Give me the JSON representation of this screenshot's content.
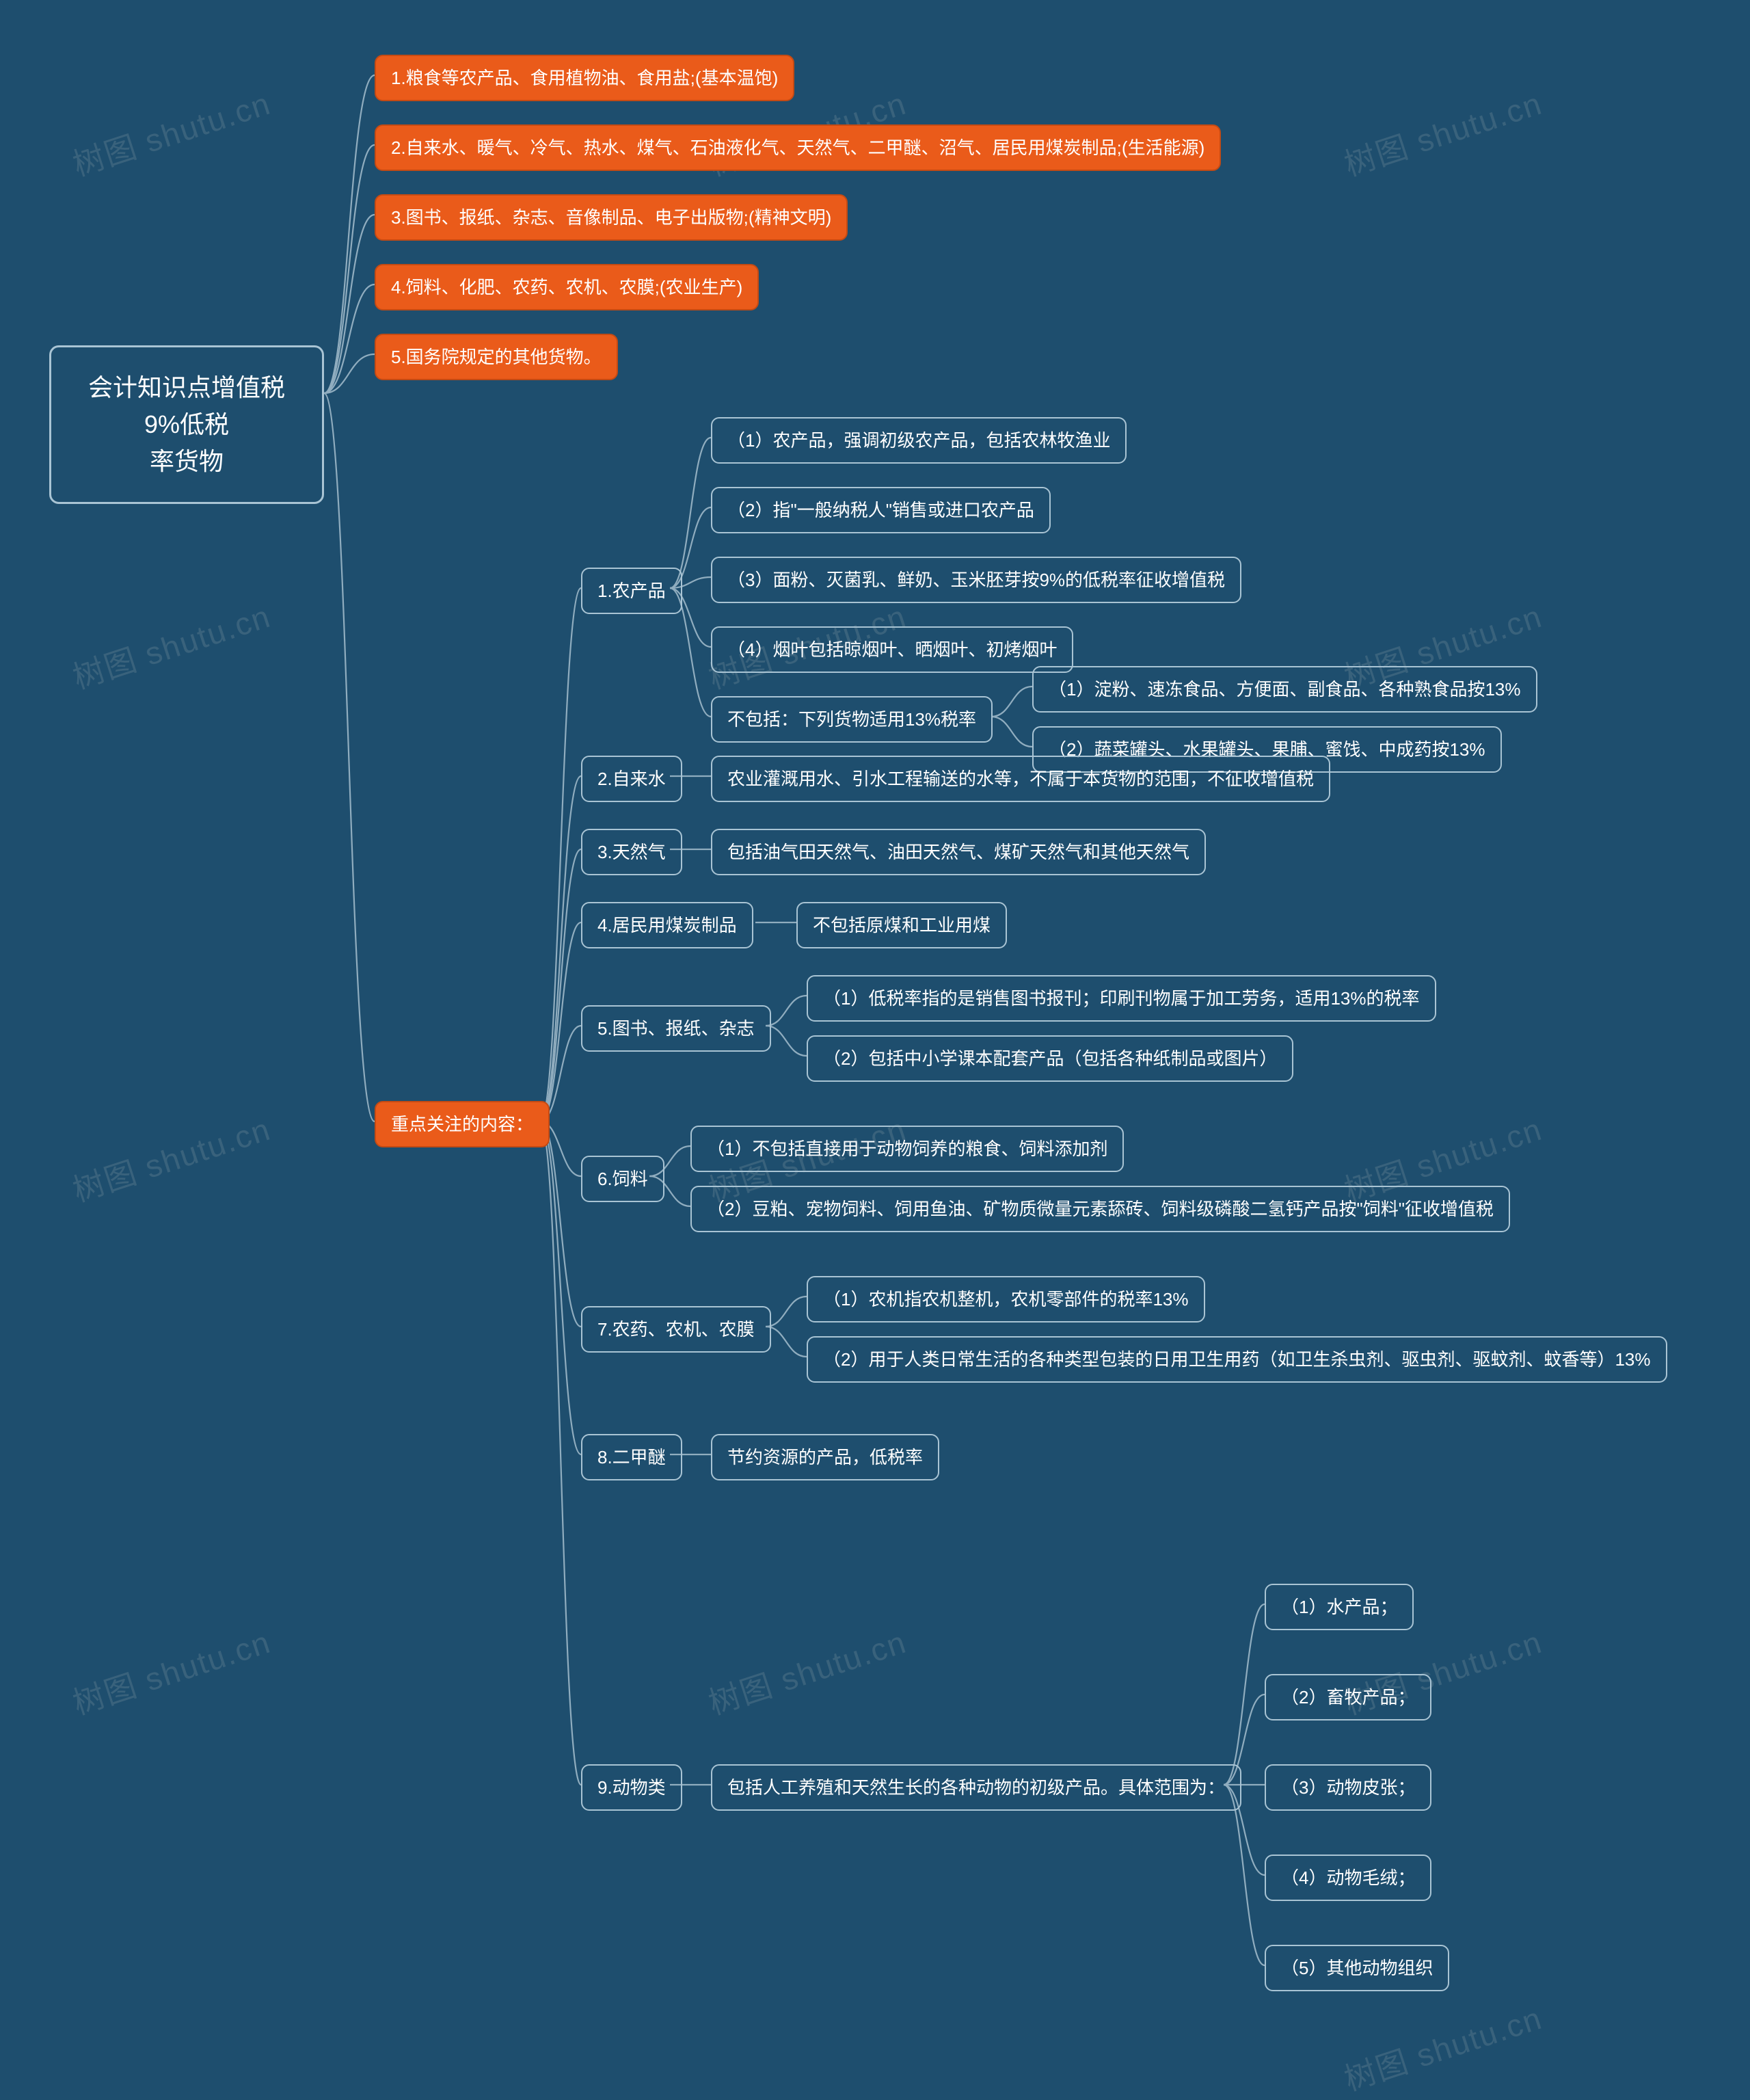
{
  "watermark": "树图 shutu.cn",
  "root": {
    "line1": "会计知识点增值税9%低税",
    "line2": "率货物"
  },
  "top_items": {
    "i1": "1.粮食等农产品、食用植物油、食用盐;(基本温饱)",
    "i2": "2.自来水、暖气、冷气、热水、煤气、石油液化气、天然气、二甲醚、沼气、居民用煤炭制品;(生活能源)",
    "i3": "3.图书、报纸、杂志、音像制品、电子出版物;(精神文明)",
    "i4": "4.饲料、化肥、农药、农机、农膜;(农业生产)",
    "i5": "5.国务院规定的其他货物。"
  },
  "focus_label": "重点关注的内容：",
  "focus": {
    "n1": "1.农产品",
    "n1_c1": "（1）农产品，强调初级农产品，包括农林牧渔业",
    "n1_c2": "（2）指\"一般纳税人\"销售或进口农产品",
    "n1_c3": "（3）面粉、灭菌乳、鲜奶、玉米胚芽按9%的低税率征收增值税",
    "n1_c4": "（4）烟叶包括晾烟叶、晒烟叶、初烤烟叶",
    "n1_nb": "不包括：下列货物适用13%税率",
    "n1_nb_c1": "（1）淀粉、速冻食品、方便面、副食品、各种熟食品按13%",
    "n1_nb_c2": "（2）蔬菜罐头、水果罐头、果脯、蜜饯、中成药按13%",
    "n2": "2.自来水",
    "n2_c1": "农业灌溉用水、引水工程输送的水等，不属于本货物的范围，不征收增值税",
    "n3": "3.天然气",
    "n3_c1": "包括油气田天然气、油田天然气、煤矿天然气和其他天然气",
    "n4": "4.居民用煤炭制品",
    "n4_c1": "不包括原煤和工业用煤",
    "n5": "5.图书、报纸、杂志",
    "n5_c1": "（1）低税率指的是销售图书报刊；印刷刊物属于加工劳务，适用13%的税率",
    "n5_c2": "（2）包括中小学课本配套产品（包括各种纸制品或图片）",
    "n6": "6.饲料",
    "n6_c1": "（1）不包括直接用于动物饲养的粮食、饲料添加剂",
    "n6_c2": "（2）豆粕、宠物饲料、饲用鱼油、矿物质微量元素舔砖、饲料级磷酸二氢钙产品按\"饲料\"征收增值税",
    "n7": "7.农药、农机、农膜",
    "n7_c1": "（1）农机指农机整机，农机零部件的税率13%",
    "n7_c2": "（2）用于人类日常生活的各种类型包装的日用卫生用药（如卫生杀虫剂、驱虫剂、驱蚊剂、蚊香等）13%",
    "n8": "8.二甲醚",
    "n8_c1": "节约资源的产品，低税率",
    "n9": "9.动物类",
    "n9_c1": "包括人工养殖和天然生长的各种动物的初级产品。具体范围为：",
    "n9_c1_1": "（1）水产品；",
    "n9_c1_2": "（2）畜牧产品；",
    "n9_c1_3": "（3）动物皮张；",
    "n9_c1_4": "（4）动物毛绒；",
    "n9_c1_5": "（5）其他动物组织"
  }
}
